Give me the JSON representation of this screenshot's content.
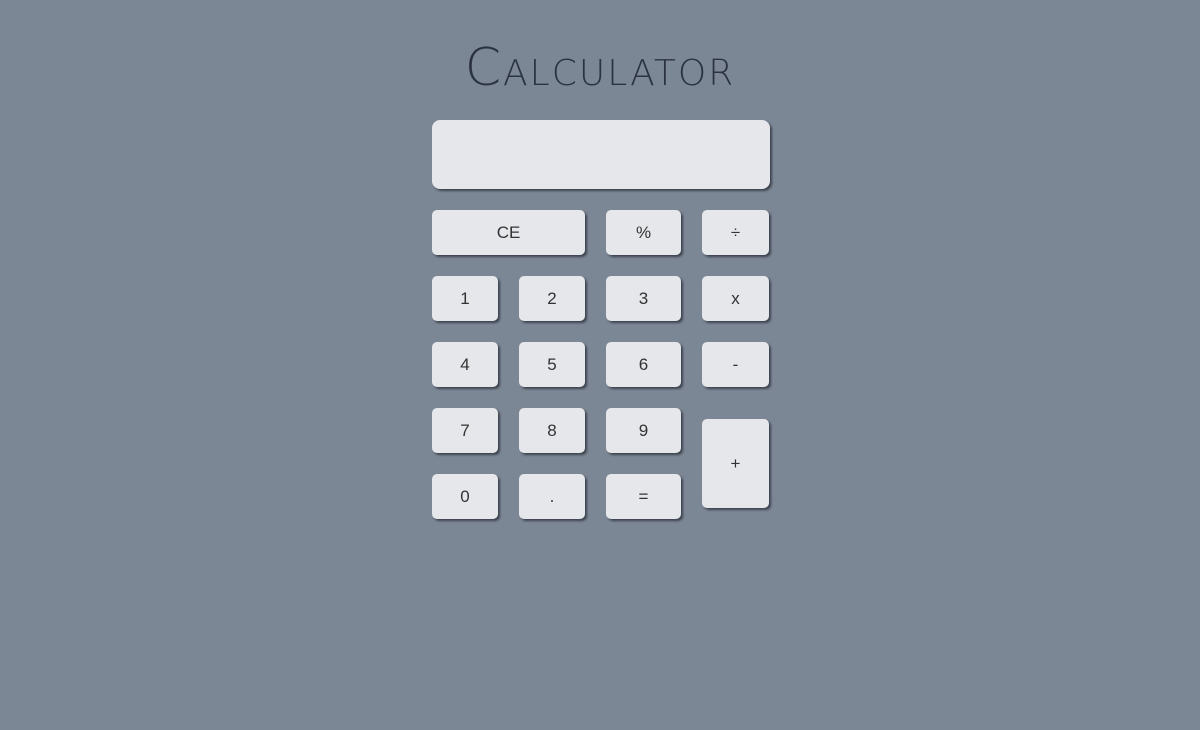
{
  "app": {
    "title": "Calculator"
  },
  "display": {
    "value": ""
  },
  "keys": {
    "clear": "CE",
    "percent": "%",
    "divide": "÷",
    "one": "1",
    "two": "2",
    "three": "3",
    "multiply": "x",
    "four": "4",
    "five": "5",
    "six": "6",
    "subtract": "-",
    "seven": "7",
    "eight": "8",
    "nine": "9",
    "add": "+",
    "zero": "0",
    "decimal": ".",
    "equals": "="
  },
  "colors": {
    "background": "#7c8795",
    "key": "#e6e7ea",
    "title": "#2b3340"
  }
}
